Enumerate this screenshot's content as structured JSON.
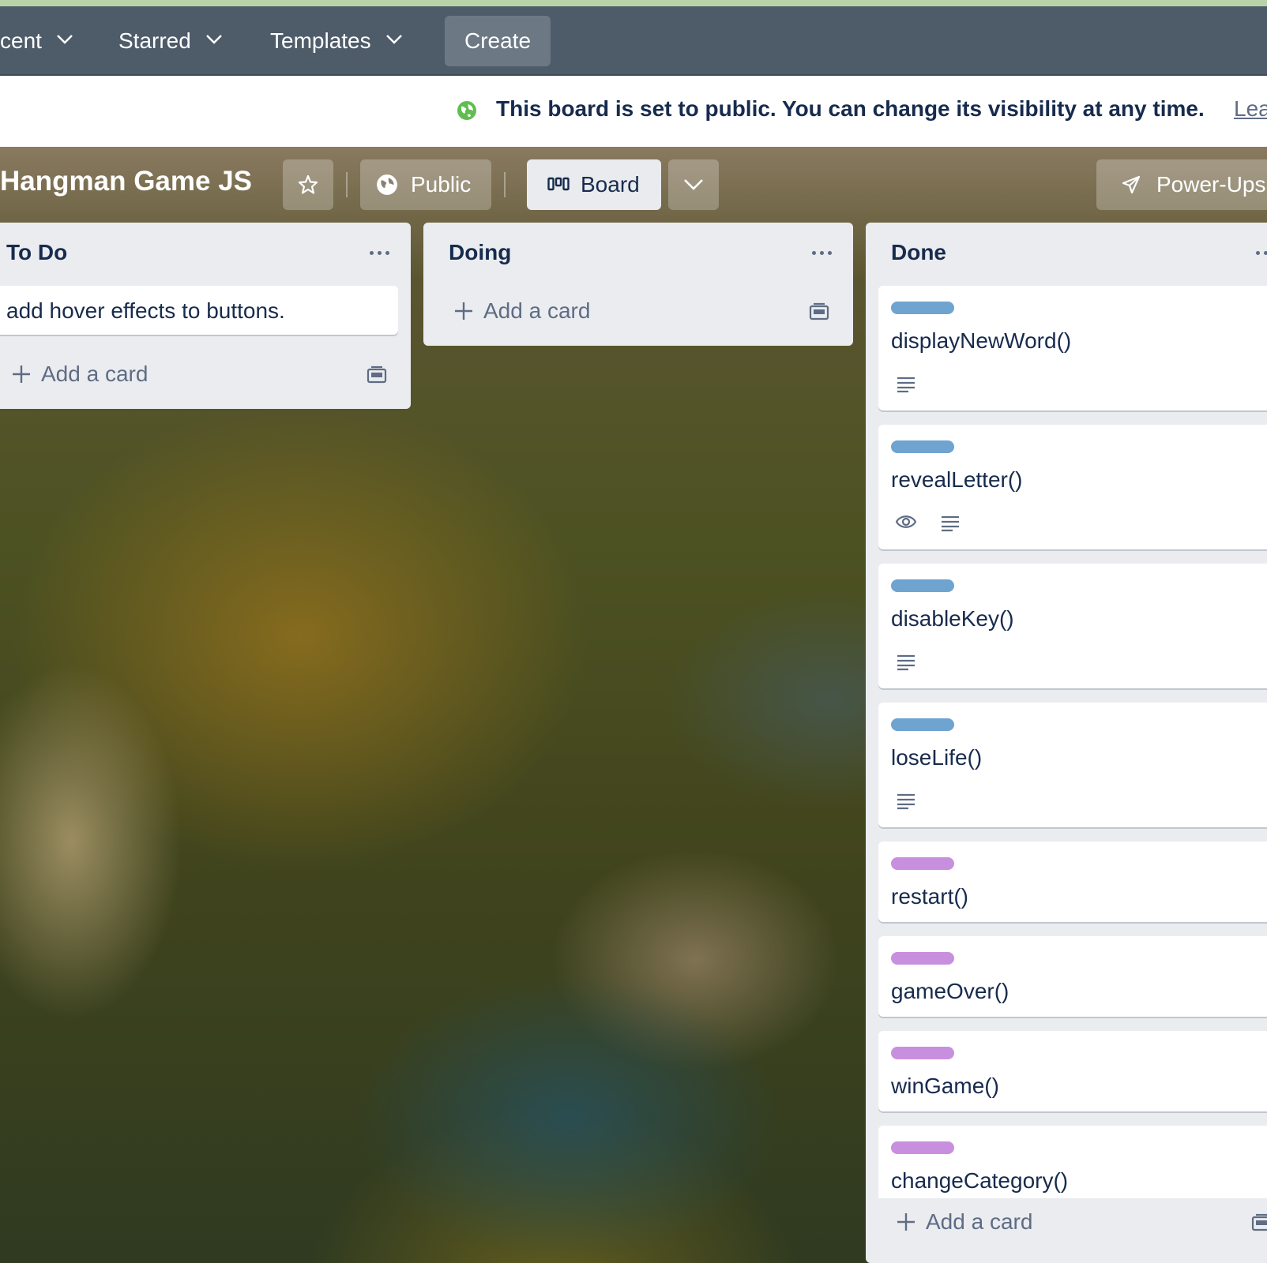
{
  "nav": {
    "recent": "cent",
    "starred": "Starred",
    "templates": "Templates",
    "create": "Create"
  },
  "notice": {
    "message": "This board is set to public. You can change its visibility at any time.",
    "link": "Lea"
  },
  "board": {
    "title": "Hangman Game JS",
    "visibility": "Public",
    "view": "Board",
    "powerups": "Power-Ups"
  },
  "lists": [
    {
      "title": "To Do",
      "cards": [
        {
          "text": "add hover effects to buttons."
        }
      ],
      "add_card": "Add a card"
    },
    {
      "title": "Doing",
      "cards": [],
      "add_card": "Add a card"
    },
    {
      "title": "Done",
      "cards": [
        {
          "text": "displayNewWord()",
          "label_color": "#6fa3d0",
          "badges": [
            "description-icon"
          ]
        },
        {
          "text": "revealLetter()",
          "label_color": "#6fa3d0",
          "badges": [
            "eye-icon",
            "description-icon"
          ]
        },
        {
          "text": "disableKey()",
          "label_color": "#6fa3d0",
          "badges": [
            "description-icon"
          ]
        },
        {
          "text": "loseLife()",
          "label_color": "#6fa3d0",
          "badges": [
            "description-icon"
          ]
        },
        {
          "text": "restart()",
          "label_color": "#c98fdf",
          "badges": []
        },
        {
          "text": "gameOver()",
          "label_color": "#c98fdf",
          "badges": []
        },
        {
          "text": "winGame()",
          "label_color": "#c98fdf",
          "badges": []
        },
        {
          "text": "changeCategory()",
          "label_color": "#c98fdf",
          "badges": []
        }
      ],
      "add_card": "Add a card"
    }
  ],
  "colors": {
    "nav_bg": "#4e5b69",
    "list_bg": "#ebecf0",
    "blue_label": "#6fa3d0",
    "purple_label": "#c98fdf",
    "text_dark": "#172b4d",
    "public_green": "#61bd4f"
  }
}
